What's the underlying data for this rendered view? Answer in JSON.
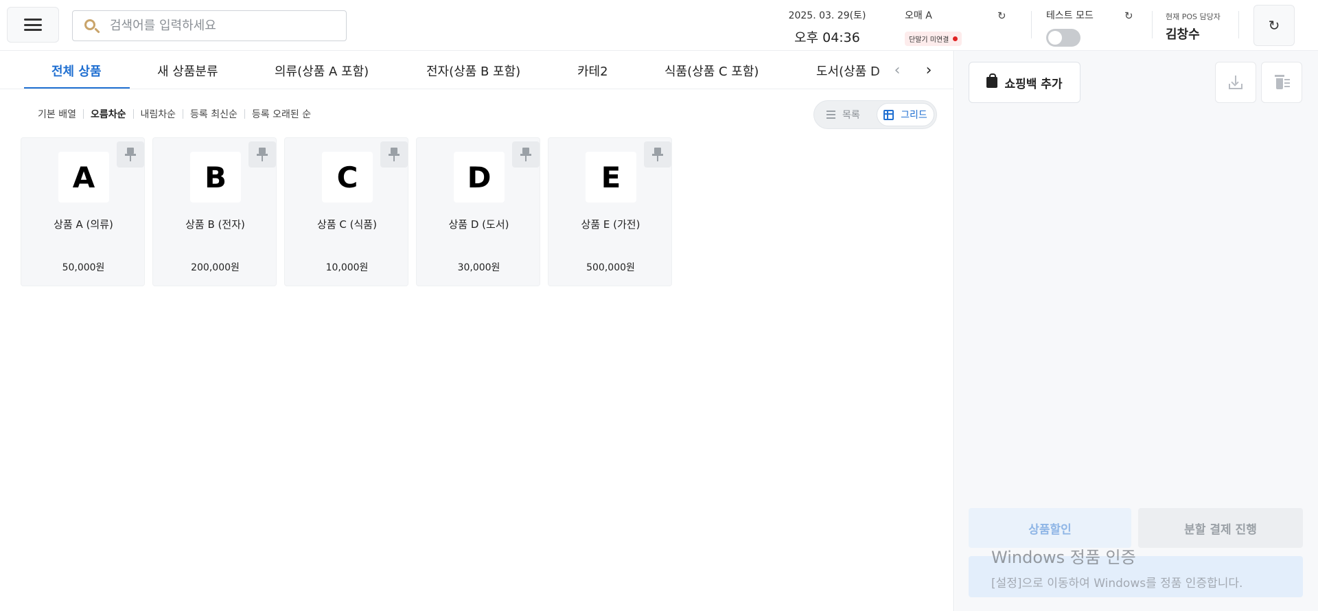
{
  "header": {
    "search_placeholder": "검색어를 입력하세요",
    "date": "2025. 03. 29(토)",
    "time": "오후 04:36",
    "store_name": "오매 A",
    "terminal_status": "단말기 미연결",
    "test_mode_label": "테스트 모드",
    "test_mode_on": false,
    "operator_label": "현재 POS 담당자",
    "operator_name": "김창수"
  },
  "tabs": [
    {
      "label": "전체 상품",
      "active": true
    },
    {
      "label": "새 상품분류",
      "active": false
    },
    {
      "label": "의류(상품 A 포함)",
      "active": false
    },
    {
      "label": "전자(상품 B 포함)",
      "active": false
    },
    {
      "label": "카테2",
      "active": false
    },
    {
      "label": "식품(상품 C 포함)",
      "active": false
    },
    {
      "label": "도서(상품 D 포함)",
      "active": false
    }
  ],
  "sort_options": [
    {
      "label": "기본 배열",
      "active": false
    },
    {
      "label": "오름차순",
      "active": true
    },
    {
      "label": "내림차순",
      "active": false
    },
    {
      "label": "등록 최신순",
      "active": false
    },
    {
      "label": "등록 오래된 순",
      "active": false
    }
  ],
  "view_toggle": {
    "list_label": "목록",
    "grid_label": "그리드",
    "selected": "grid"
  },
  "products": [
    {
      "letter": "A",
      "name": "상품 A (의류)",
      "price": "50,000원"
    },
    {
      "letter": "B",
      "name": "상품 B (전자)",
      "price": "200,000원"
    },
    {
      "letter": "C",
      "name": "상품 C (식품)",
      "price": "10,000원"
    },
    {
      "letter": "D",
      "name": "상품 D (도서)",
      "price": "30,000원"
    },
    {
      "letter": "E",
      "name": "상품 E (가전)",
      "price": "500,000원"
    }
  ],
  "cart": {
    "add_bag_label": "쇼핑백 추가",
    "discount_label": "상품할인",
    "split_pay_label": "분할 결제 진행"
  },
  "watermark": {
    "title": "Windows 정품 인증",
    "subtitle": "[설정]으로 이동하여 Windows를 정품 인증합니다."
  },
  "colors": {
    "accent": "#1f6fd1",
    "status_dot": "#e02424"
  }
}
